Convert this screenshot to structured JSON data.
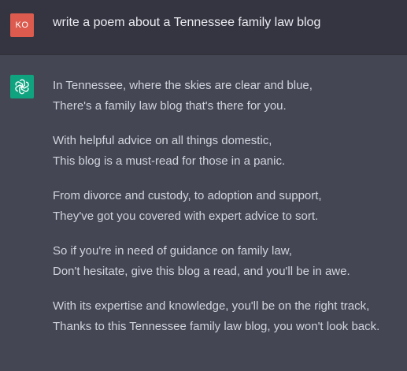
{
  "user_message": {
    "avatar_initials": "KO",
    "text": "write a poem about a Tennessee family law blog"
  },
  "assistant_message": {
    "avatar_icon": "openai-logo-icon",
    "stanzas": [
      [
        "In Tennessee, where the skies are clear and blue,",
        "There's a family law blog that's there for you."
      ],
      [
        "With helpful advice on all things domestic,",
        "This blog is a must-read for those in a panic."
      ],
      [
        "From divorce and custody, to adoption and support,",
        "They've got you covered with expert advice to sort."
      ],
      [
        "So if you're in need of guidance on family law,",
        "Don't hesitate, give this blog a read, and you'll be in awe."
      ],
      [
        "With its expertise and knowledge, you'll be on the right track,",
        "Thanks to this Tennessee family law blog, you won't look back."
      ]
    ]
  },
  "colors": {
    "user_avatar_bg": "#dc5b4e",
    "assistant_avatar_bg": "#10a37f",
    "user_row_bg": "#343541",
    "assistant_row_bg": "#444654"
  }
}
